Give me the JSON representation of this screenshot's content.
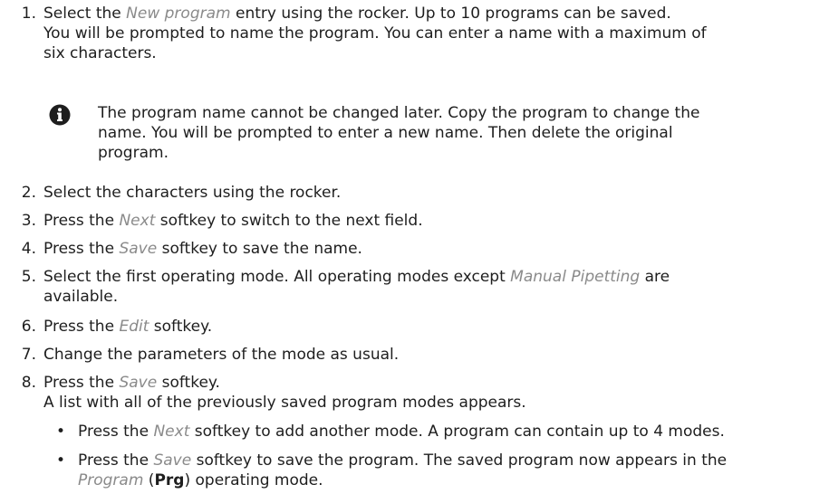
{
  "steps": [
    {
      "num": "1.",
      "lines": [
        [
          {
            "t": "Select the "
          },
          {
            "t": "New program",
            "i": true
          },
          {
            "t": " entry using the rocker. Up to 10 programs can be saved."
          }
        ],
        [
          {
            "t": "You will be prompted to name the program. You can enter a name with a maximum of"
          }
        ],
        [
          {
            "t": "six characters."
          }
        ]
      ]
    },
    {
      "num": "2.",
      "lines": [
        [
          {
            "t": "Select the characters using the rocker."
          }
        ]
      ]
    },
    {
      "num": "3.",
      "lines": [
        [
          {
            "t": "Press the "
          },
          {
            "t": "Next",
            "i": true
          },
          {
            "t": " softkey to switch to the next field."
          }
        ]
      ]
    },
    {
      "num": "4.",
      "lines": [
        [
          {
            "t": "Press the "
          },
          {
            "t": "Save",
            "i": true
          },
          {
            "t": " softkey to save the name."
          }
        ]
      ]
    },
    {
      "num": "5.",
      "lines": [
        [
          {
            "t": "Select the first operating mode. All operating modes except "
          },
          {
            "t": "Manual Pipetting",
            "i": true
          },
          {
            "t": " are"
          }
        ],
        [
          {
            "t": "available."
          }
        ]
      ]
    },
    {
      "num": "6.",
      "lines": [
        [
          {
            "t": "Press the "
          },
          {
            "t": "Edit",
            "i": true
          },
          {
            "t": " softkey."
          }
        ]
      ]
    },
    {
      "num": "7.",
      "lines": [
        [
          {
            "t": "Change the parameters of the mode as usual."
          }
        ]
      ]
    },
    {
      "num": "8.",
      "lines": [
        [
          {
            "t": "Press the "
          },
          {
            "t": "Save",
            "i": true
          },
          {
            "t": " softkey."
          }
        ],
        [
          {
            "t": "A list with all of the previously saved program modes appears."
          }
        ]
      ]
    }
  ],
  "note": {
    "icon": "info-icon",
    "lines": [
      [
        {
          "t": "The program name cannot be changed later. Copy the program to change the"
        }
      ],
      [
        {
          "t": "name. You will be prompted to enter a new name. Then delete the original"
        }
      ],
      [
        {
          "t": "program."
        }
      ]
    ]
  },
  "bullets": [
    {
      "mark": "•",
      "lines": [
        [
          {
            "t": "Press the "
          },
          {
            "t": "Next",
            "i": true
          },
          {
            "t": " softkey to add another mode. A program can contain up to 4 modes."
          }
        ]
      ]
    },
    {
      "mark": "•",
      "lines": [
        [
          {
            "t": "Press the "
          },
          {
            "t": "Save",
            "i": true
          },
          {
            "t": " softkey to save the program. The saved program now appears in the"
          }
        ],
        [
          {
            "t": "Program",
            "i": true
          },
          {
            "t": " ("
          },
          {
            "t": "Prg",
            "b": true
          },
          {
            "t": ") operating mode."
          }
        ]
      ]
    }
  ],
  "colors": {
    "text": "#1e1e1e",
    "emphasis": "#8a8a8a",
    "icon": "#1e1e1e"
  }
}
